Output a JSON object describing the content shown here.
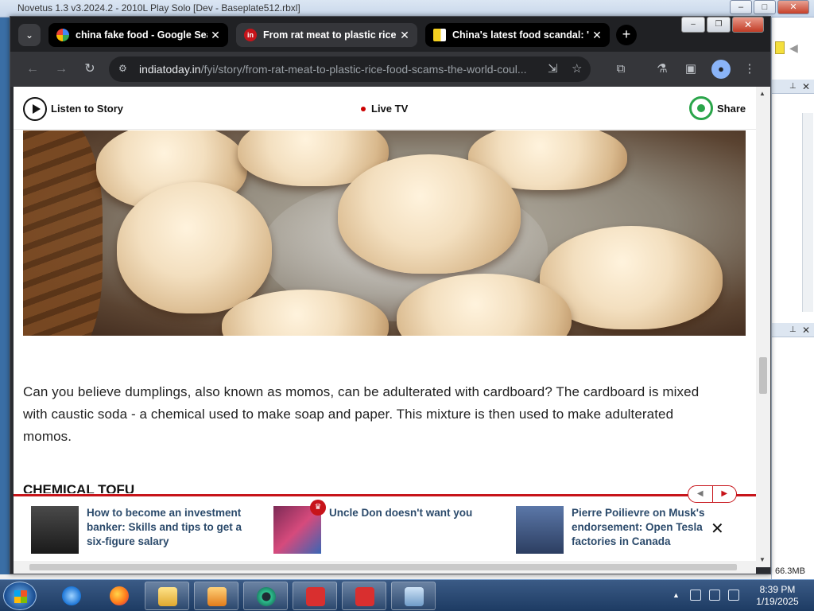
{
  "background_app": {
    "title": "Novetus 1.3 v3.2024.2 - 2010L Play Solo [Dev - Baseplate512.rbxl]",
    "memory": "66.3MB"
  },
  "browser": {
    "tabs": [
      {
        "title": "china fake food - Google Search",
        "close": "✕"
      },
      {
        "title": "From rat meat to plastic rice, food scams",
        "close": "✕"
      },
      {
        "title": "China's latest food scandal: 'le",
        "close": "✕"
      }
    ],
    "new_tab": "+",
    "url_host": "indiatoday.in",
    "url_path": "/fyi/story/from-rat-meat-to-plastic-rice-food-scams-the-world-coul..."
  },
  "page": {
    "listen_label": "Listen to Story",
    "live_label": "Live TV",
    "share_label": "Share",
    "body_text": "Can you believe dumplings, also known as momos, can be adulterated with cardboard? The cardboard is mixed with caustic soda - a chemical used to make soap and paper. This mixture is then used to make adulterated momos.",
    "section_heading": "CHEMICAL TOFU",
    "trending": [
      {
        "text": "How to become an investment banker: Skills and tips to get a six-figure salary"
      },
      {
        "text": "Uncle Don doesn't want you"
      },
      {
        "text": "Pierre Poilievre on Musk's endorsement: Open Tesla factories in Canada"
      }
    ],
    "trending_close": "✕"
  },
  "taskbar": {
    "time": "8:39 PM",
    "date": "1/19/2025"
  },
  "colors": {
    "accent_red": "#c7141a",
    "whatsapp_green": "#2aa54a",
    "link_blue": "#2b4a6b"
  }
}
